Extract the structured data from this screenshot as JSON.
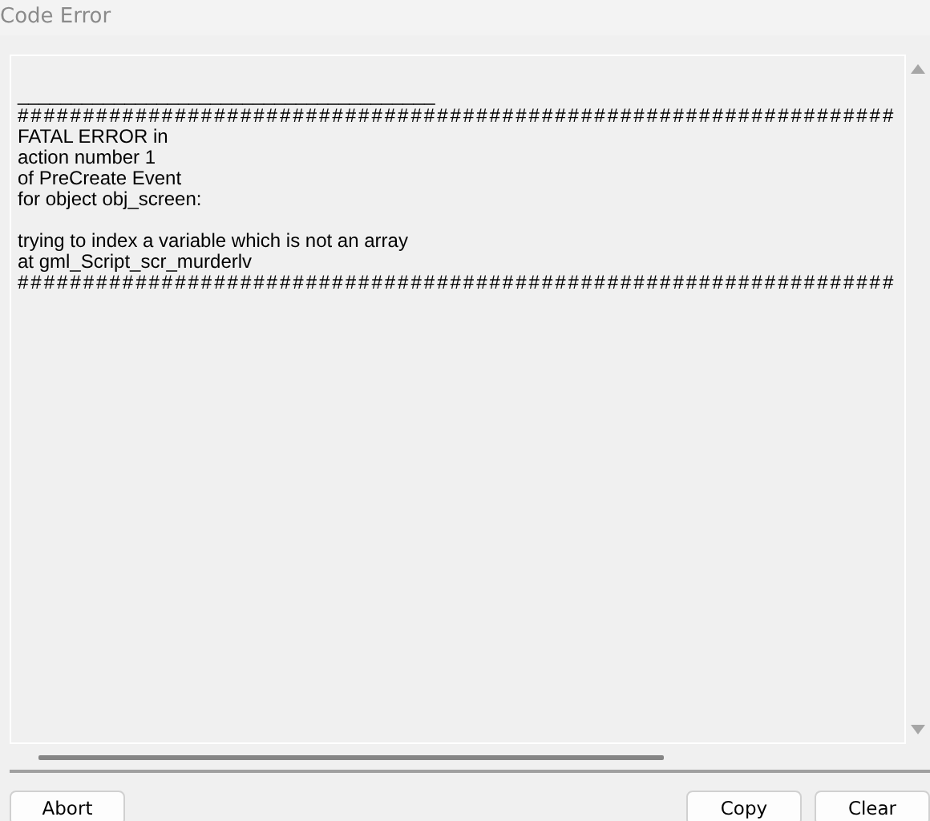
{
  "window": {
    "title": "Code Error"
  },
  "log": {
    "lines": [
      {
        "kind": "blank"
      },
      {
        "kind": "rule",
        "text": "_______________________________________"
      },
      {
        "kind": "hashes",
        "text": "###################################################################"
      },
      {
        "kind": "text",
        "text": "FATAL ERROR in"
      },
      {
        "kind": "text",
        "text": "action number 1"
      },
      {
        "kind": "text",
        "text": "of PreCreate Event"
      },
      {
        "kind": "text",
        "text": "for object obj_screen:"
      },
      {
        "kind": "blank"
      },
      {
        "kind": "text",
        "text": "trying to index a variable which is not an array"
      },
      {
        "kind": "text",
        "text": "at gml_Script_scr_murderlv"
      },
      {
        "kind": "hashes",
        "text": "###################################################################"
      }
    ]
  },
  "buttons_left": [
    "Abort"
  ],
  "buttons_right": [
    "Copy",
    "Clear"
  ]
}
